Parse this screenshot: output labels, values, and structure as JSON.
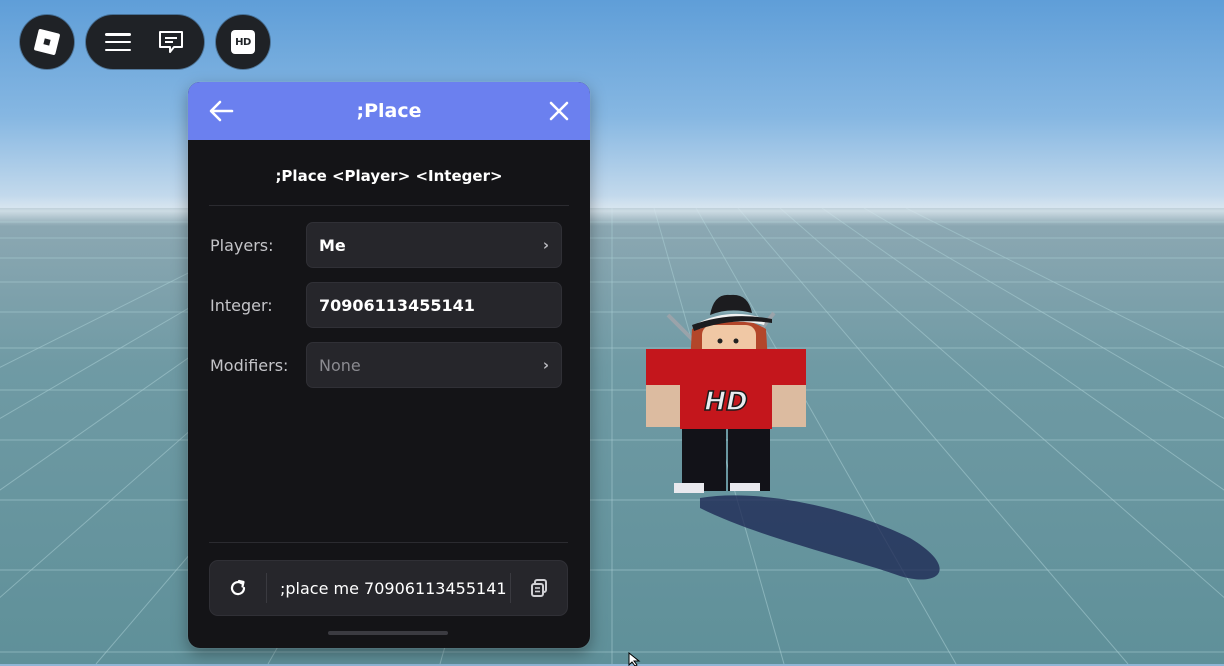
{
  "topbar": {
    "logo_icon": "roblox-logo-icon",
    "menu_icon": "hamburger-menu-icon",
    "chat_icon": "chat-icon",
    "hd_badge_text": "HD"
  },
  "panel": {
    "title": ";Place",
    "header_color": "#6b80ef",
    "syntax": ";Place <Player> <Integer>",
    "fields": [
      {
        "label": "Players:",
        "value": "Me",
        "has_chevron": true,
        "muted": false
      },
      {
        "label": "Integer:",
        "value": "70906113455141",
        "has_chevron": false,
        "muted": false
      },
      {
        "label": "Modifiers:",
        "value": "None",
        "has_chevron": true,
        "muted": true
      }
    ],
    "command_preview": ";place me 70906113455141",
    "chevron": "›"
  },
  "avatar": {
    "shirt_text": "HD",
    "shirt_color": "#c4161c"
  },
  "scene": {
    "sky_color": "#6aa6dc",
    "ground_color": "#6f9aa4"
  }
}
